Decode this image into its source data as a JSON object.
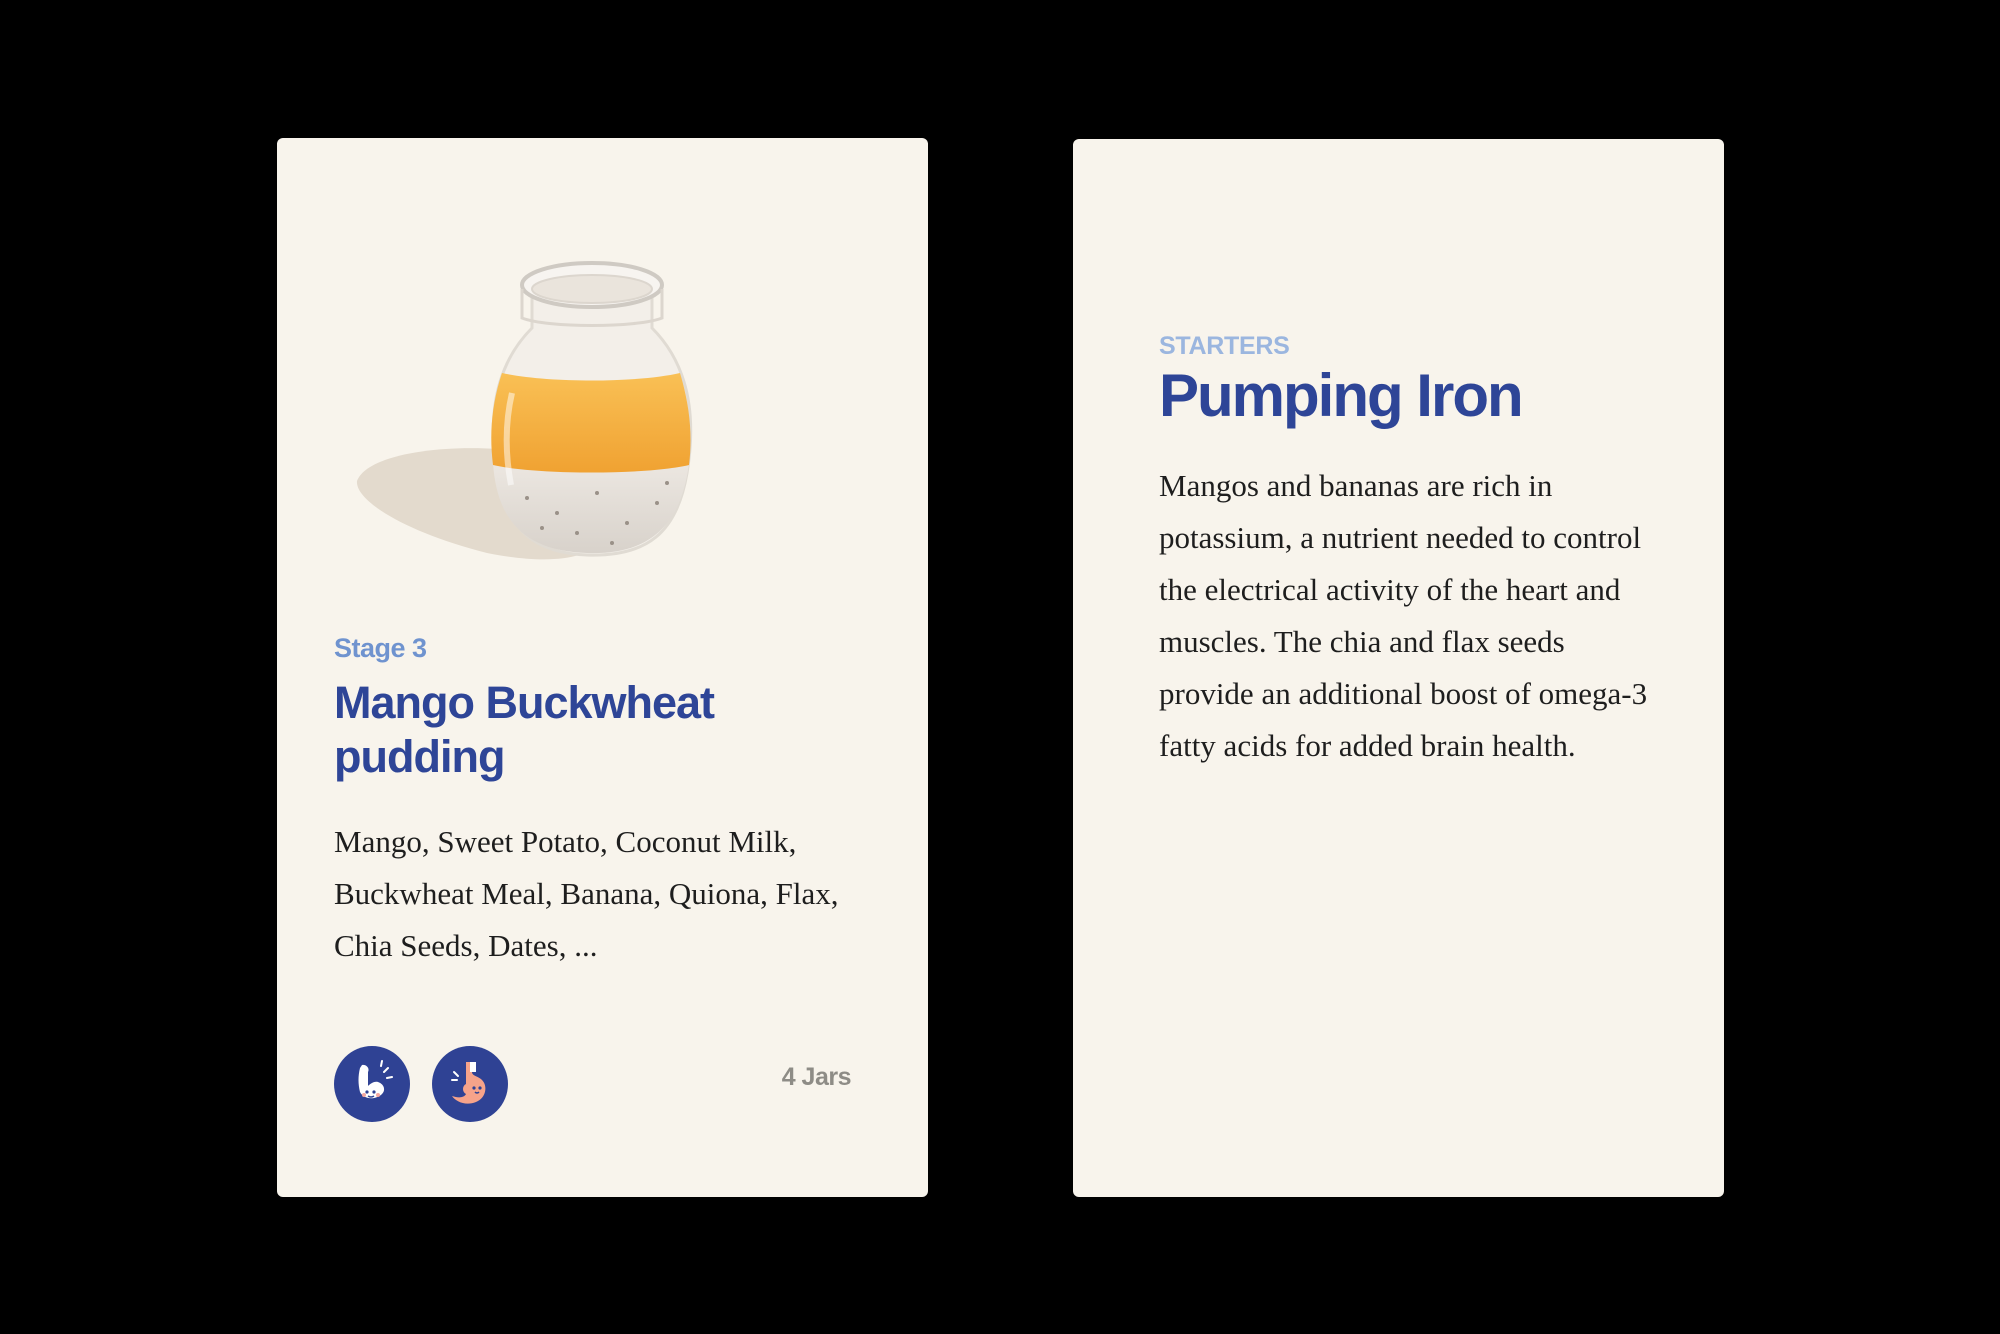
{
  "front_card": {
    "stage": "Stage 3",
    "title": "Mango Buckwheat pudding",
    "ingredients": "Mango, Sweet Potato, Coconut Milk, Buckwheat Meal, Banana, Quiona, Flax, Chia Seeds, Dates, ...",
    "badges": [
      "muscle-icon",
      "stomach-icon"
    ],
    "jar_count": "4 Jars"
  },
  "back_card": {
    "category": "STARTERS",
    "title": "Pumping Iron",
    "description": "Mangos and bananas are rich in potassium, a nutrient needed to control the electrical activity of the heart and muscles. The chia and flax seeds provide an additional boost of omega-3 fatty acids for added brain health."
  },
  "colors": {
    "background": "#000000",
    "card": "#F8F4EC",
    "title_blue": "#2E4597",
    "stage_blue": "#6F93CF",
    "category_blue": "#9BB6DF",
    "badge_blue": "#2F4294",
    "muted_gray": "#8E8C86",
    "mango_orange": "#F5B23E"
  }
}
